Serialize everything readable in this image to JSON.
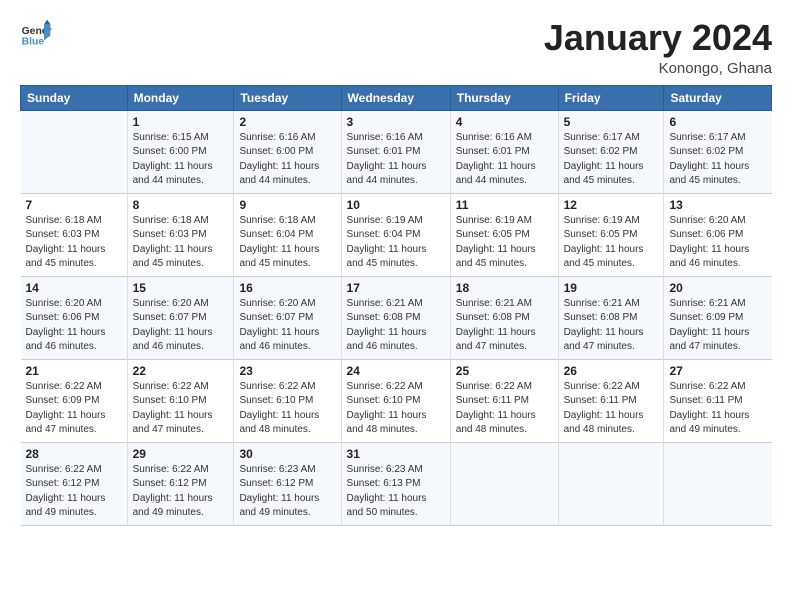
{
  "header": {
    "logo_general": "General",
    "logo_blue": "Blue",
    "month_title": "January 2024",
    "location": "Konongo, Ghana"
  },
  "columns": [
    "Sunday",
    "Monday",
    "Tuesday",
    "Wednesday",
    "Thursday",
    "Friday",
    "Saturday"
  ],
  "weeks": [
    [
      {
        "day": "",
        "sunrise": "",
        "sunset": "",
        "daylight": ""
      },
      {
        "day": "1",
        "sunrise": "Sunrise: 6:15 AM",
        "sunset": "Sunset: 6:00 PM",
        "daylight": "Daylight: 11 hours and 44 minutes."
      },
      {
        "day": "2",
        "sunrise": "Sunrise: 6:16 AM",
        "sunset": "Sunset: 6:00 PM",
        "daylight": "Daylight: 11 hours and 44 minutes."
      },
      {
        "day": "3",
        "sunrise": "Sunrise: 6:16 AM",
        "sunset": "Sunset: 6:01 PM",
        "daylight": "Daylight: 11 hours and 44 minutes."
      },
      {
        "day": "4",
        "sunrise": "Sunrise: 6:16 AM",
        "sunset": "Sunset: 6:01 PM",
        "daylight": "Daylight: 11 hours and 44 minutes."
      },
      {
        "day": "5",
        "sunrise": "Sunrise: 6:17 AM",
        "sunset": "Sunset: 6:02 PM",
        "daylight": "Daylight: 11 hours and 45 minutes."
      },
      {
        "day": "6",
        "sunrise": "Sunrise: 6:17 AM",
        "sunset": "Sunset: 6:02 PM",
        "daylight": "Daylight: 11 hours and 45 minutes."
      }
    ],
    [
      {
        "day": "7",
        "sunrise": "Sunrise: 6:18 AM",
        "sunset": "Sunset: 6:03 PM",
        "daylight": "Daylight: 11 hours and 45 minutes."
      },
      {
        "day": "8",
        "sunrise": "Sunrise: 6:18 AM",
        "sunset": "Sunset: 6:03 PM",
        "daylight": "Daylight: 11 hours and 45 minutes."
      },
      {
        "day": "9",
        "sunrise": "Sunrise: 6:18 AM",
        "sunset": "Sunset: 6:04 PM",
        "daylight": "Daylight: 11 hours and 45 minutes."
      },
      {
        "day": "10",
        "sunrise": "Sunrise: 6:19 AM",
        "sunset": "Sunset: 6:04 PM",
        "daylight": "Daylight: 11 hours and 45 minutes."
      },
      {
        "day": "11",
        "sunrise": "Sunrise: 6:19 AM",
        "sunset": "Sunset: 6:05 PM",
        "daylight": "Daylight: 11 hours and 45 minutes."
      },
      {
        "day": "12",
        "sunrise": "Sunrise: 6:19 AM",
        "sunset": "Sunset: 6:05 PM",
        "daylight": "Daylight: 11 hours and 45 minutes."
      },
      {
        "day": "13",
        "sunrise": "Sunrise: 6:20 AM",
        "sunset": "Sunset: 6:06 PM",
        "daylight": "Daylight: 11 hours and 46 minutes."
      }
    ],
    [
      {
        "day": "14",
        "sunrise": "Sunrise: 6:20 AM",
        "sunset": "Sunset: 6:06 PM",
        "daylight": "Daylight: 11 hours and 46 minutes."
      },
      {
        "day": "15",
        "sunrise": "Sunrise: 6:20 AM",
        "sunset": "Sunset: 6:07 PM",
        "daylight": "Daylight: 11 hours and 46 minutes."
      },
      {
        "day": "16",
        "sunrise": "Sunrise: 6:20 AM",
        "sunset": "Sunset: 6:07 PM",
        "daylight": "Daylight: 11 hours and 46 minutes."
      },
      {
        "day": "17",
        "sunrise": "Sunrise: 6:21 AM",
        "sunset": "Sunset: 6:08 PM",
        "daylight": "Daylight: 11 hours and 46 minutes."
      },
      {
        "day": "18",
        "sunrise": "Sunrise: 6:21 AM",
        "sunset": "Sunset: 6:08 PM",
        "daylight": "Daylight: 11 hours and 47 minutes."
      },
      {
        "day": "19",
        "sunrise": "Sunrise: 6:21 AM",
        "sunset": "Sunset: 6:08 PM",
        "daylight": "Daylight: 11 hours and 47 minutes."
      },
      {
        "day": "20",
        "sunrise": "Sunrise: 6:21 AM",
        "sunset": "Sunset: 6:09 PM",
        "daylight": "Daylight: 11 hours and 47 minutes."
      }
    ],
    [
      {
        "day": "21",
        "sunrise": "Sunrise: 6:22 AM",
        "sunset": "Sunset: 6:09 PM",
        "daylight": "Daylight: 11 hours and 47 minutes."
      },
      {
        "day": "22",
        "sunrise": "Sunrise: 6:22 AM",
        "sunset": "Sunset: 6:10 PM",
        "daylight": "Daylight: 11 hours and 47 minutes."
      },
      {
        "day": "23",
        "sunrise": "Sunrise: 6:22 AM",
        "sunset": "Sunset: 6:10 PM",
        "daylight": "Daylight: 11 hours and 48 minutes."
      },
      {
        "day": "24",
        "sunrise": "Sunrise: 6:22 AM",
        "sunset": "Sunset: 6:10 PM",
        "daylight": "Daylight: 11 hours and 48 minutes."
      },
      {
        "day": "25",
        "sunrise": "Sunrise: 6:22 AM",
        "sunset": "Sunset: 6:11 PM",
        "daylight": "Daylight: 11 hours and 48 minutes."
      },
      {
        "day": "26",
        "sunrise": "Sunrise: 6:22 AM",
        "sunset": "Sunset: 6:11 PM",
        "daylight": "Daylight: 11 hours and 48 minutes."
      },
      {
        "day": "27",
        "sunrise": "Sunrise: 6:22 AM",
        "sunset": "Sunset: 6:11 PM",
        "daylight": "Daylight: 11 hours and 49 minutes."
      }
    ],
    [
      {
        "day": "28",
        "sunrise": "Sunrise: 6:22 AM",
        "sunset": "Sunset: 6:12 PM",
        "daylight": "Daylight: 11 hours and 49 minutes."
      },
      {
        "day": "29",
        "sunrise": "Sunrise: 6:22 AM",
        "sunset": "Sunset: 6:12 PM",
        "daylight": "Daylight: 11 hours and 49 minutes."
      },
      {
        "day": "30",
        "sunrise": "Sunrise: 6:23 AM",
        "sunset": "Sunset: 6:12 PM",
        "daylight": "Daylight: 11 hours and 49 minutes."
      },
      {
        "day": "31",
        "sunrise": "Sunrise: 6:23 AM",
        "sunset": "Sunset: 6:13 PM",
        "daylight": "Daylight: 11 hours and 50 minutes."
      },
      {
        "day": "",
        "sunrise": "",
        "sunset": "",
        "daylight": ""
      },
      {
        "day": "",
        "sunrise": "",
        "sunset": "",
        "daylight": ""
      },
      {
        "day": "",
        "sunrise": "",
        "sunset": "",
        "daylight": ""
      }
    ]
  ]
}
